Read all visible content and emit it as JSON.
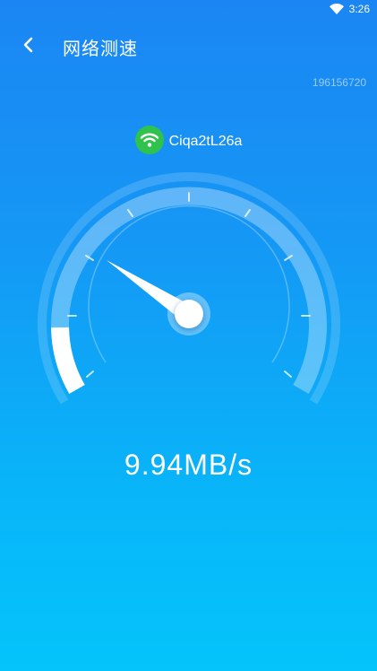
{
  "status_bar": {
    "time": "3:26",
    "wifi_icon": "wifi-icon"
  },
  "header": {
    "back_icon": "chevron-left-icon",
    "title": "网络测速"
  },
  "device_id": "196156720",
  "network": {
    "icon": "wifi-badge-icon",
    "name": "Ciqa2tL26a"
  },
  "speed": {
    "value": "9.94MB/s"
  },
  "gauge": {
    "progress_fraction": 0.12
  },
  "colors": {
    "background_top": "#1b86f3",
    "background_bottom": "#04c4fb",
    "wifi_badge": "#2fc34d",
    "gauge_fill": "#ffffff"
  }
}
